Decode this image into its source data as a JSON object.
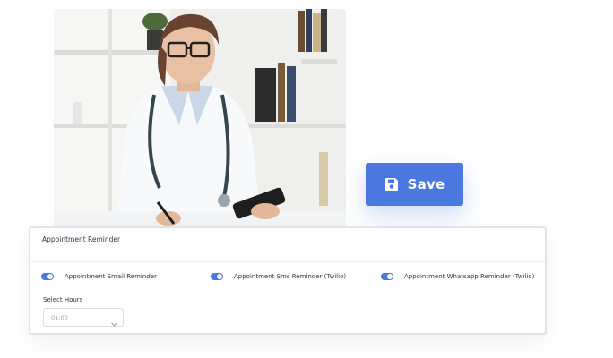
{
  "save_button": {
    "label": "Save",
    "icon": "floppy-disk-icon"
  },
  "panel": {
    "title": "Appointment Reminder",
    "toggles": [
      {
        "label": "Appointment Email Reminder",
        "on": true
      },
      {
        "label": "Appointment Sms Reminder (Twilio)",
        "on": true
      },
      {
        "label": "Appointment Whatsapp Reminder (Twilio)",
        "on": true
      }
    ],
    "select_hours_label": "Select Hours",
    "select_hours_value": "01:00"
  },
  "colors": {
    "accent": "#4a78e0",
    "panel_border": "#dfe3ea",
    "text": "#2d3748"
  }
}
